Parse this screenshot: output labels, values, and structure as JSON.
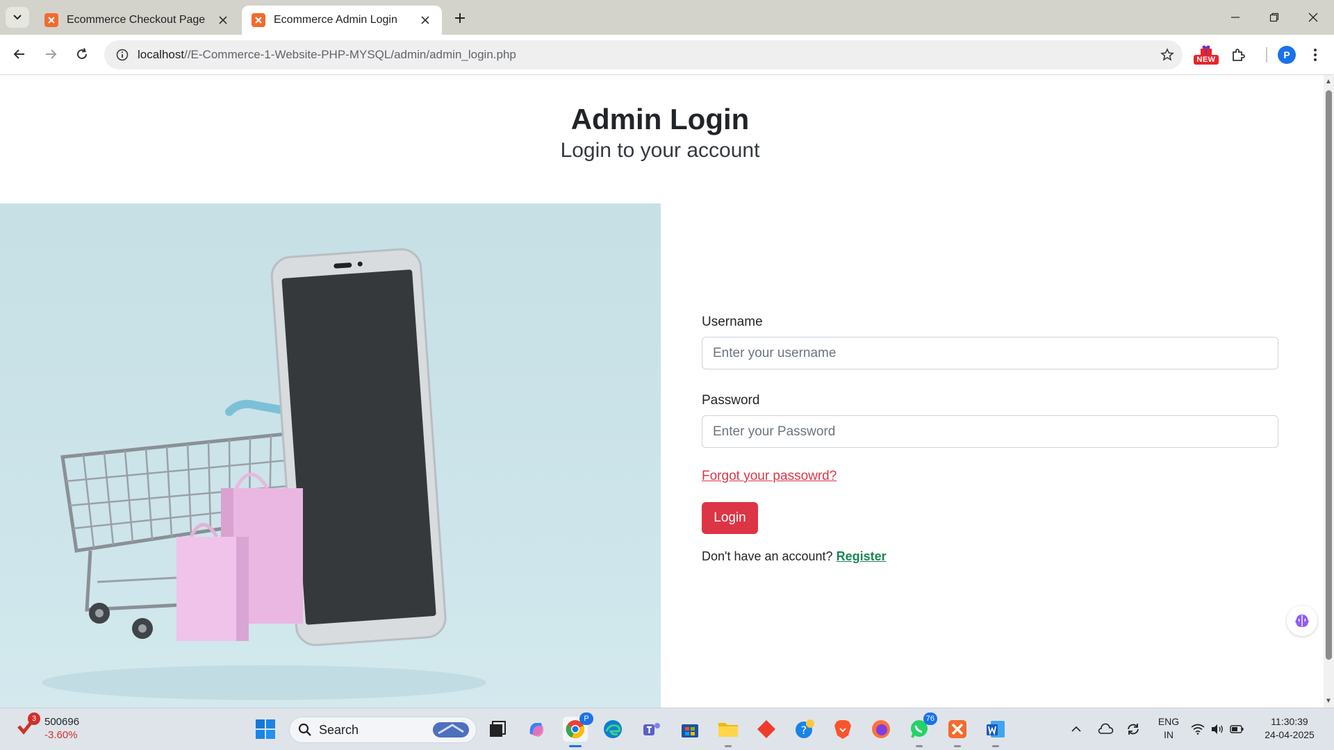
{
  "browser": {
    "tabs": [
      {
        "title": "Ecommerce Checkout Page",
        "active": false
      },
      {
        "title": "Ecommerce Admin Login",
        "active": true
      }
    ],
    "url_host": "localhost",
    "url_path": "//E-Commerce-1-Website-PHP-MYSQL/admin/admin_login.php",
    "new_badge": "NEW",
    "profile_initial": "P"
  },
  "page": {
    "heading": "Admin Login",
    "subheading": "Login to your account",
    "username_label": "Username",
    "username_placeholder": "Enter your username",
    "password_label": "Password",
    "password_placeholder": "Enter your Password",
    "forgot_link": "Forgot your passowrd?",
    "login_button": "Login",
    "signup_prompt": "Don't have an account?",
    "register_link": "Register"
  },
  "taskbar": {
    "stock_count": "3",
    "stock_value": "500696",
    "stock_change": "-3.60%",
    "search_label": "Search",
    "chrome_badge": "P",
    "whatsapp_badge": "76",
    "language_line1": "ENG",
    "language_line2": "IN",
    "time": "11:30:39",
    "date": "24-04-2025"
  },
  "colors": {
    "accent_red": "#dc3545",
    "register_green": "#198754",
    "hero_bg": "#c6e0e6"
  }
}
